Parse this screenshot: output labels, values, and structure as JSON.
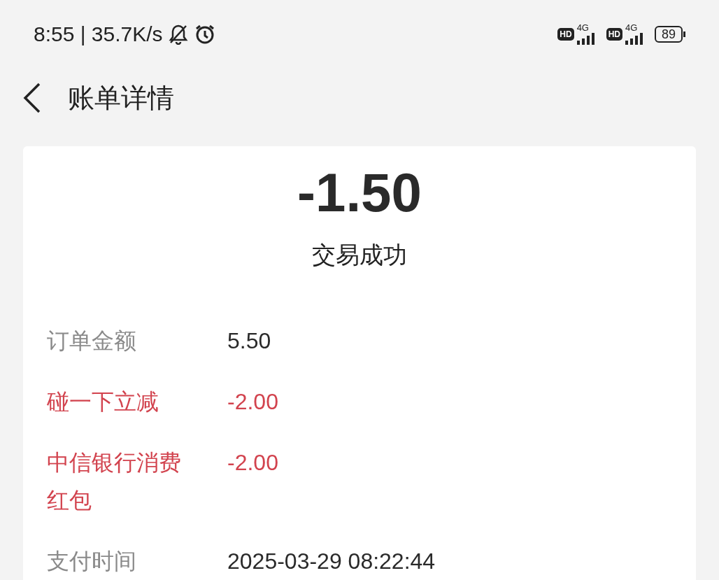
{
  "status_bar": {
    "time": "8:55 | 35.7K/s",
    "sims": [
      {
        "hd": "HD",
        "network": "4G"
      },
      {
        "hd": "HD",
        "network": "4G"
      }
    ],
    "battery": "89"
  },
  "header": {
    "title": "账单详情"
  },
  "summary": {
    "amount": "-1.50",
    "status": "交易成功"
  },
  "details": [
    {
      "label": "订单金额",
      "value": "5.50",
      "highlight": false
    },
    {
      "label": "碰一下立减",
      "value": "-2.00",
      "highlight": true
    },
    {
      "label": "中信银行消费红包",
      "value": "-2.00",
      "highlight": true
    },
    {
      "label": "支付时间",
      "value": "2025-03-29 08:22:44",
      "highlight": false
    }
  ]
}
